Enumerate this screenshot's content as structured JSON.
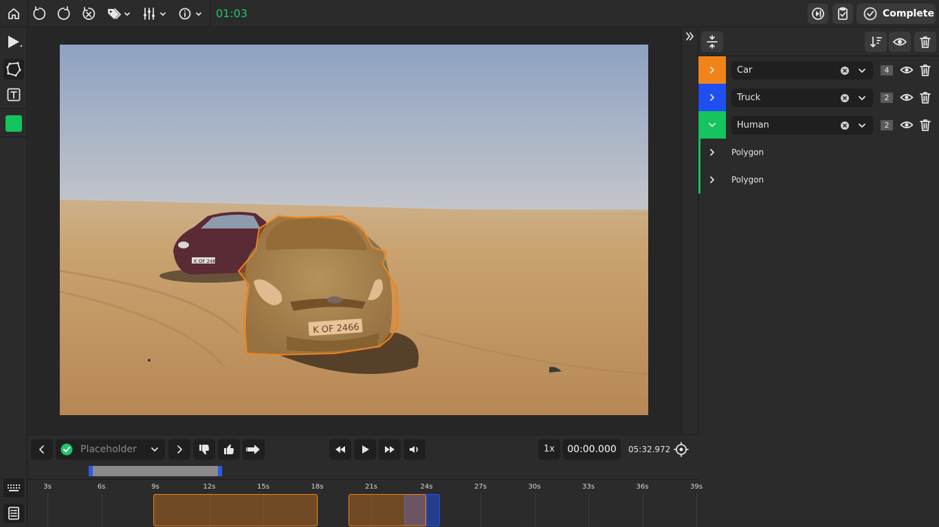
{
  "toolbar": {
    "timer": "01:03",
    "complete_label": "Complete"
  },
  "sidebar": {
    "active_color": "#16c45f"
  },
  "classes": [
    {
      "name": "Car",
      "count": "4",
      "color": "#f08418",
      "expanded": false
    },
    {
      "name": "Truck",
      "count": "2",
      "color": "#1f4ff0",
      "expanded": false
    },
    {
      "name": "Human",
      "count": "2",
      "color": "#16c45f",
      "expanded": true
    }
  ],
  "instances": [
    {
      "label": "Polygon"
    },
    {
      "label": "Polygon"
    }
  ],
  "player": {
    "status_placeholder": "Placeholder",
    "speed": "1x",
    "current_time": "00:00.000",
    "duration": "05:32.972"
  },
  "timeline": {
    "ticks": [
      "3s",
      "6s",
      "9s",
      "12s",
      "15s",
      "18s",
      "21s",
      "24s",
      "27s",
      "30s",
      "33s",
      "36s",
      "39s"
    ]
  },
  "image": {
    "plate_text": "K OF 2466",
    "plate_text_back": "K OF 246"
  }
}
